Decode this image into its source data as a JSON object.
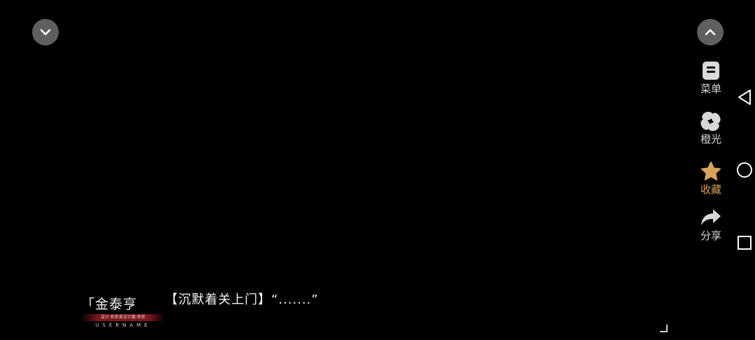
{
  "controls": {
    "collapse_icon": "chevron-down-icon",
    "expand_icon": "chevron-up-icon"
  },
  "side_menu": {
    "items": [
      {
        "label": "菜单",
        "icon": "menu-document-icon"
      },
      {
        "label": "橙光",
        "icon": "orange-light-pinwheel-icon"
      },
      {
        "label": "收藏",
        "icon": "star-icon"
      },
      {
        "label": "分享",
        "icon": "share-arrow-icon"
      }
    ],
    "favorite_color": "#d9a35a",
    "icon_color": "#d8d8d8"
  },
  "dialogue": {
    "speaker": "「金泰亨",
    "badge_subtext": "设计·抓抓美设计篇·抓抓",
    "badge_username": "USERNAME",
    "line": "【沉默着关上门】“.......”"
  },
  "system_nav": {
    "back_icon": "triangle-back-icon",
    "home_icon": "circle-home-icon",
    "recent_icon": "square-recent-icon"
  }
}
